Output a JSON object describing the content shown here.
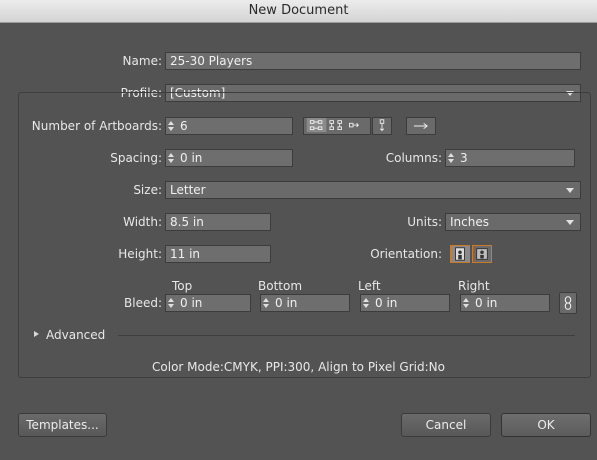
{
  "window": {
    "title": "New Document"
  },
  "name": {
    "label": "Name:",
    "value": "25-30 Players"
  },
  "profile": {
    "label": "Profile:",
    "value": "[Custom]"
  },
  "artboards": {
    "label": "Number of Artboards:",
    "value": "6"
  },
  "spacing": {
    "label": "Spacing:",
    "value": "0 in"
  },
  "columns": {
    "label": "Columns:",
    "value": "3"
  },
  "size": {
    "label": "Size:",
    "value": "Letter"
  },
  "width": {
    "label": "Width:",
    "value": "8.5 in"
  },
  "units": {
    "label": "Units:",
    "value": "Inches"
  },
  "height": {
    "label": "Height:",
    "value": "11 in"
  },
  "orientation": {
    "label": "Orientation:",
    "selected": "portrait"
  },
  "bleed": {
    "label": "Bleed:",
    "top": {
      "label": "Top",
      "value": "0 in"
    },
    "bottom": {
      "label": "Bottom",
      "value": "0 in"
    },
    "left": {
      "label": "Left",
      "value": "0 in"
    },
    "right": {
      "label": "Right",
      "value": "0 in"
    }
  },
  "advanced": {
    "label": "Advanced"
  },
  "summary": "Color Mode:CMYK, PPI:300, Align to Pixel Grid:No",
  "buttons": {
    "templates": "Templates...",
    "cancel": "Cancel",
    "ok": "OK"
  },
  "icons": {
    "grid_by_row": "grid-by-row-icon",
    "grid_by_column": "grid-by-column-icon",
    "arrange_by_row": "arrange-by-row-icon",
    "arrange_by_column": "arrange-by-column-icon",
    "rtl_layout": "right-arrow-icon",
    "link_bleed": "link-icon"
  },
  "colors": {
    "accent": "#c97a2a",
    "background": "#535353",
    "field": "#6e6e6e"
  }
}
